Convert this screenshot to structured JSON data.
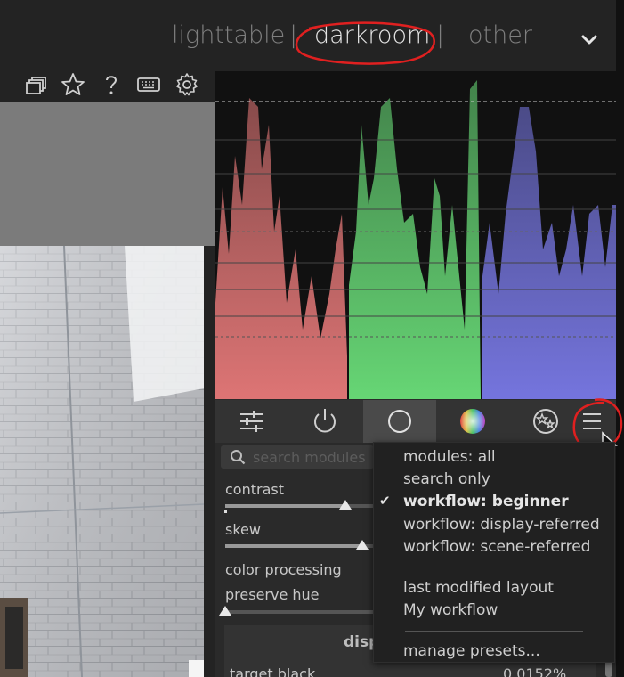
{
  "header": {
    "views": [
      {
        "label": "lighttable"
      },
      {
        "label": "darkroom"
      },
      {
        "label": "other"
      }
    ],
    "separator": "|"
  },
  "toolbar_icons": [
    "overlapping-windows-icon",
    "star-icon",
    "help-icon",
    "keyboard-icon",
    "gear-icon"
  ],
  "module_tabs": [
    "sliders-icon",
    "power-icon",
    "circle-icon",
    "color-wheel-icon",
    "magic-effect-icon",
    "hamburger-menu-icon"
  ],
  "search": {
    "placeholder": "search modules"
  },
  "modules": {
    "contrast_label": "contrast",
    "contrast_value": 0.81,
    "skew_label": "skew",
    "skew_value": 0.92,
    "color_processing_label": "color processing",
    "preserve_hue_label": "preserve hue",
    "preserve_hue_value": 0.0,
    "section_title": "disp",
    "target_black_label": "target black",
    "target_black_value": "0.0152%"
  },
  "preset_menu": {
    "group1": [
      "modules: all",
      "search only",
      "workflow: beginner",
      "workflow: display-referred",
      "workflow: scene-referred"
    ],
    "checked_item": "workflow: beginner",
    "group2": [
      "last modified layout",
      "My workflow"
    ],
    "group3": [
      "manage presets..."
    ]
  },
  "colors": {
    "accent_red": "#e02020",
    "waveform_red": "#e87a7a",
    "waveform_green": "#6be07a",
    "waveform_blue": "#7a7ae8"
  }
}
